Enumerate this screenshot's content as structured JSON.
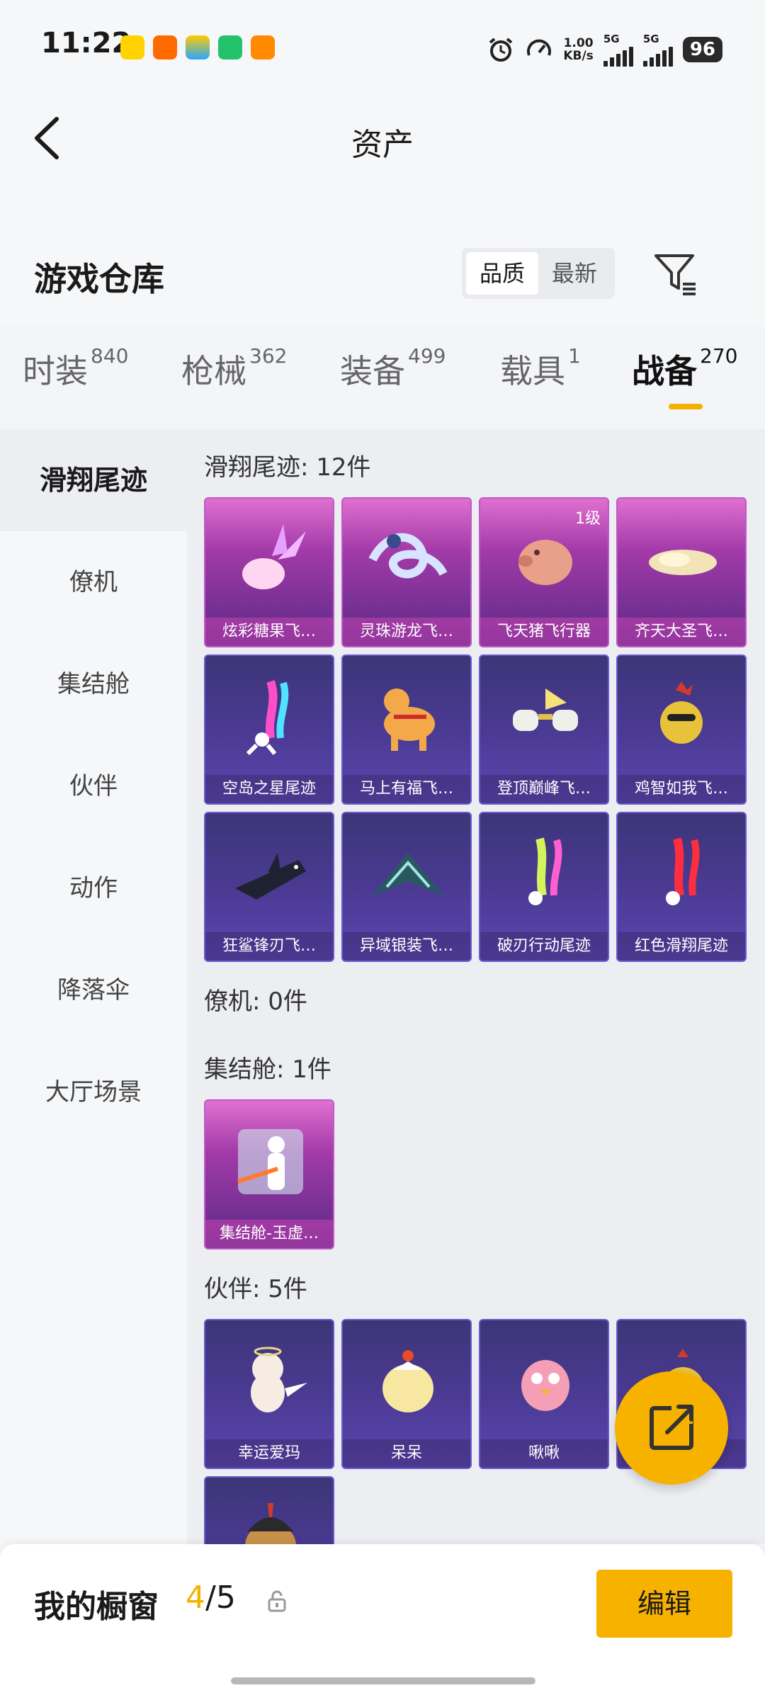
{
  "status_bar": {
    "time": "11:22",
    "net_speed": "1.00\nKB/s",
    "net_speed_value": "1.00",
    "net_speed_unit": "KB/s",
    "net_type_1": "5G",
    "net_type_2": "5G",
    "battery": "96"
  },
  "header": {
    "title": "资产"
  },
  "warehouse": {
    "title": "游戏仓库",
    "sort_quality": "品质",
    "sort_latest": "最新"
  },
  "tabs": [
    {
      "label": "时装",
      "count": "840"
    },
    {
      "label": "枪械",
      "count": "362"
    },
    {
      "label": "装备",
      "count": "499"
    },
    {
      "label": "载具",
      "count": "1"
    },
    {
      "label": "战备",
      "count": "270"
    }
  ],
  "sidebar": [
    {
      "label": "滑翔尾迹"
    },
    {
      "label": "僚机"
    },
    {
      "label": "集结舱"
    },
    {
      "label": "伙伴"
    },
    {
      "label": "动作"
    },
    {
      "label": "降落伞"
    },
    {
      "label": "大厅场景"
    }
  ],
  "sections": {
    "trails": {
      "title": "滑翔尾迹: 12件",
      "items": [
        {
          "name": "炫彩糖果飞…"
        },
        {
          "name": "灵珠游龙飞…"
        },
        {
          "name": "飞天猪飞行器",
          "badge": "1级"
        },
        {
          "name": "齐天大圣飞…"
        },
        {
          "name": "空岛之星尾迹"
        },
        {
          "name": "马上有福飞…"
        },
        {
          "name": "登顶巅峰飞…"
        },
        {
          "name": "鸡智如我飞…"
        },
        {
          "name": "狂鲨锋刃飞…"
        },
        {
          "name": "异域银装飞…"
        },
        {
          "name": "破刃行动尾迹"
        },
        {
          "name": "红色滑翔尾迹"
        }
      ]
    },
    "wingman": {
      "title": "僚机: 0件"
    },
    "pod": {
      "title": "集结舱: 1件",
      "items": [
        {
          "name": "集结舱-玉虚…"
        }
      ]
    },
    "partner": {
      "title": "伙伴: 5件",
      "items": [
        {
          "name": "幸运爱玛"
        },
        {
          "name": "呆呆"
        },
        {
          "name": "啾啾"
        },
        {
          "name": ""
        }
      ]
    }
  },
  "bottom_bar": {
    "label": "我的橱窗",
    "count_current": "4",
    "count_sep": "/5",
    "edit": "编辑"
  },
  "colors": {
    "accent": "#f7b200",
    "card_pink": "#b23fb0",
    "card_purple": "#4a3a92"
  }
}
